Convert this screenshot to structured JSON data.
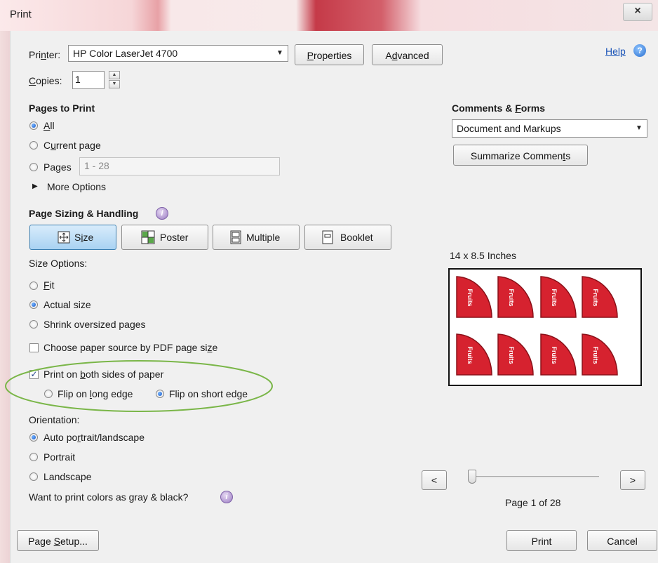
{
  "window": {
    "title": "Print",
    "close_glyph": "×"
  },
  "printer": {
    "label": "Printer:",
    "value": "HP Color LaserJet 4700",
    "properties": "Properties",
    "advanced": "Advanced"
  },
  "help": {
    "label": "Help",
    "icon": "?"
  },
  "copies": {
    "label": "Copies:",
    "value": "1"
  },
  "pages_to_print": {
    "heading": "Pages to Print",
    "all": "All",
    "current_page": "Current page",
    "pages": "Pages",
    "pages_value": "1 - 28",
    "more_options": "More Options",
    "selected": "All"
  },
  "comments_forms": {
    "heading": "Comments & Forms",
    "value": "Document and Markups",
    "summarize": "Summarize Comments"
  },
  "sizing": {
    "heading": "Page Sizing & Handling",
    "info_icon": "i",
    "tabs": [
      "Size",
      "Poster",
      "Multiple",
      "Booklet"
    ],
    "selected_tab": "Size",
    "size_options_label": "Size Options:",
    "fit": "Fit",
    "actual_size": "Actual size",
    "shrink": "Shrink oversized pages",
    "selected_option": "Actual size",
    "paper_source": "Choose paper source by PDF page size",
    "paper_source_checked": false
  },
  "duplex": {
    "label": "Print on both sides of paper",
    "checked": true,
    "flip_long": "Flip on long edge",
    "flip_short": "Flip on short edge",
    "selected": "Flip on short edge",
    "highlight_color": "#7ab648"
  },
  "orientation": {
    "label": "Orientation:",
    "auto": "Auto portrait/landscape",
    "portrait": "Portrait",
    "landscape": "Landscape",
    "selected": "Auto portrait/landscape"
  },
  "gray": {
    "label": "Want to print colors as gray & black?",
    "info_icon": "i"
  },
  "preview": {
    "size_label": "14 x 8.5 Inches",
    "tile_text": "Fruits",
    "tile_color": "#d6222f",
    "tile_count": 8,
    "prev": "<",
    "next": ">",
    "page_indicator": "Page 1 of 28",
    "slider_position": 0.0
  },
  "footer": {
    "page_setup": "Page Setup...",
    "print": "Print",
    "cancel": "Cancel"
  }
}
